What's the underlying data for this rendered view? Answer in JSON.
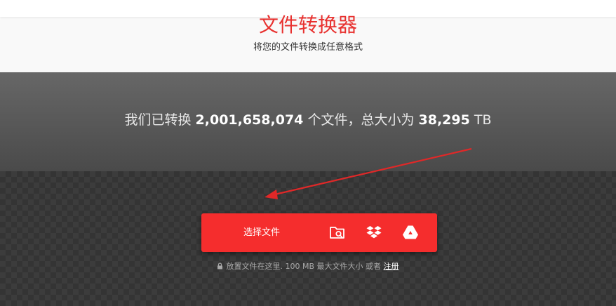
{
  "header": {
    "title": "文件转换器",
    "subtitle": "将您的文件转换成任意格式"
  },
  "stats": {
    "prefix": "我们已转换",
    "file_count": "2,001,658,074",
    "middle": "个文件，总大小为",
    "total_size": "38,295",
    "unit": "TB"
  },
  "upload": {
    "choose_label": "选择文件",
    "sources": [
      "folder-search-icon",
      "dropbox-icon",
      "google-drive-icon"
    ]
  },
  "note": {
    "text": "放置文件在这里. 100 MB 最大文件大小 或者",
    "signup_link": "注册"
  },
  "colors": {
    "accent": "#f52d2d",
    "title_red": "#e8312f",
    "annotation_arrow": "#e02828"
  }
}
